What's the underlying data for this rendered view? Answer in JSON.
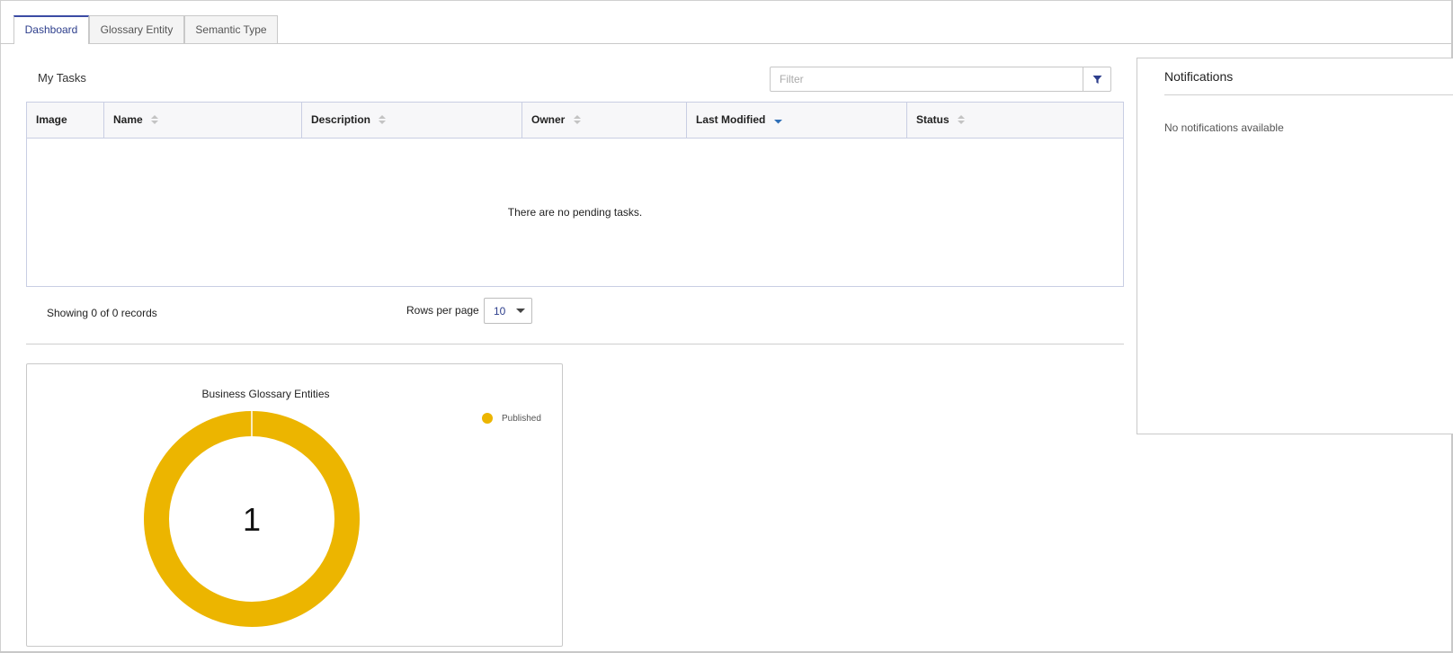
{
  "tabs": [
    {
      "label": "Dashboard",
      "active": true
    },
    {
      "label": "Glossary Entity",
      "active": false
    },
    {
      "label": "Semantic Type",
      "active": false
    }
  ],
  "tasks": {
    "title": "My Tasks",
    "filter_placeholder": "Filter",
    "filter_icon": "filter-icon",
    "columns": [
      {
        "label": "Image",
        "sortable": false
      },
      {
        "label": "Name",
        "sortable": true
      },
      {
        "label": "Description",
        "sortable": true
      },
      {
        "label": "Owner",
        "sortable": true
      },
      {
        "label": "Last Modified",
        "sortable": true,
        "sort": "desc"
      },
      {
        "label": "Status",
        "sortable": true
      }
    ],
    "empty_message": "There are no pending tasks.",
    "records_text": "Showing 0 of 0 records",
    "rows_per_page_label": "Rows per page",
    "rows_per_page_value": "10"
  },
  "chart": {
    "legend_label": "Published",
    "center_value": "1"
  },
  "chart_data": {
    "type": "pie",
    "title": "Business Glossary Entities",
    "categories": [
      "Published"
    ],
    "values": [
      1
    ],
    "colors": [
      "#ecb500"
    ],
    "donut": true,
    "legend": "top-right"
  },
  "notifications": {
    "title": "Notifications",
    "empty_message": "No notifications available"
  },
  "colors": {
    "accent": "#3b4ba4",
    "published": "#ecb500",
    "sort_active": "#2f6fb7"
  }
}
